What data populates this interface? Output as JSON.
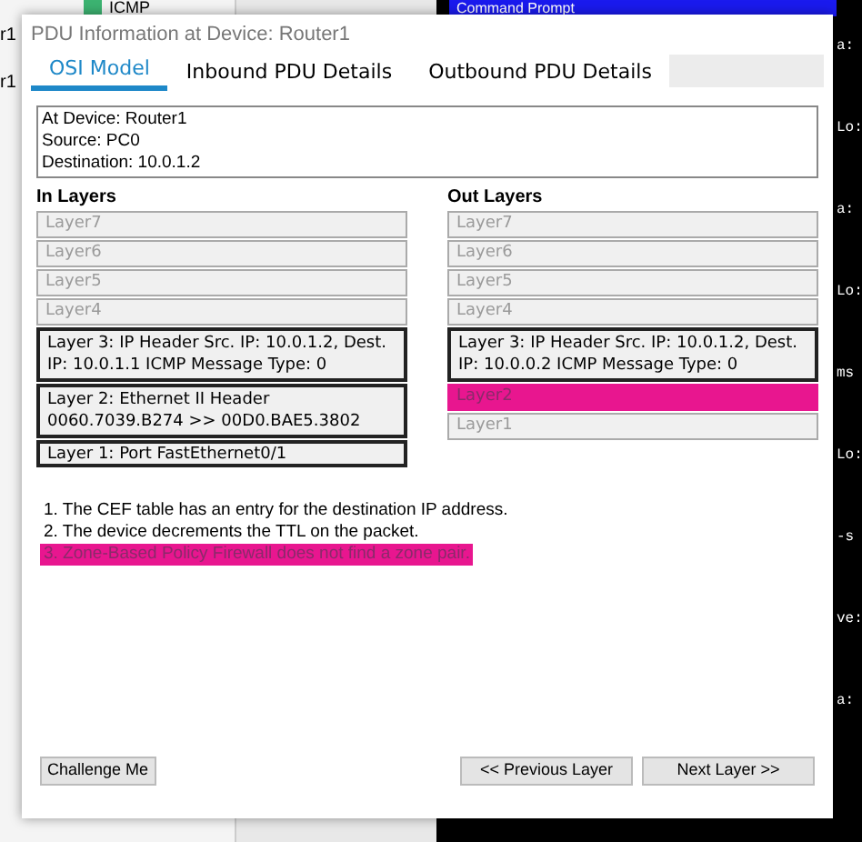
{
  "background": {
    "list_item": "ICMP",
    "terminal_title": "Command Prompt",
    "left_labels": [
      "r1",
      "r1"
    ],
    "terminal_lines": [
      "a:",
      "Lo:",
      "a:",
      "Lo:",
      "ms",
      "Lo:",
      "-s",
      "ve:",
      "a:"
    ]
  },
  "window": {
    "title": "PDU Information at Device: Router1"
  },
  "tabs": [
    {
      "label": "OSI Model",
      "selected": true
    },
    {
      "label": "Inbound PDU Details",
      "selected": false
    },
    {
      "label": "Outbound PDU Details",
      "selected": false
    }
  ],
  "info": [
    "At Device: Router1",
    "Source: PC0",
    "Destination: 10.0.1.2"
  ],
  "in_layers": {
    "heading": "In Layers",
    "layers": [
      {
        "text": "Layer7",
        "active": false,
        "highlighted": false
      },
      {
        "text": "Layer6",
        "active": false,
        "highlighted": false
      },
      {
        "text": "Layer5",
        "active": false,
        "highlighted": false
      },
      {
        "text": "Layer4",
        "active": false,
        "highlighted": false
      },
      {
        "text": "Layer 3: IP Header Src. IP: 10.0.1.2, Dest. IP: 10.0.1.1 ICMP Message Type: 0",
        "active": true,
        "highlighted": false
      },
      {
        "text": "Layer 2: Ethernet II Header 0060.7039.B274 >> 00D0.BAE5.3802",
        "active": true,
        "highlighted": false
      },
      {
        "text": "Layer 1: Port FastEthernet0/1",
        "active": true,
        "highlighted": false
      }
    ]
  },
  "out_layers": {
    "heading": "Out Layers",
    "layers": [
      {
        "text": "Layer7",
        "active": false,
        "highlighted": false
      },
      {
        "text": "Layer6",
        "active": false,
        "highlighted": false
      },
      {
        "text": "Layer5",
        "active": false,
        "highlighted": false
      },
      {
        "text": "Layer4",
        "active": false,
        "highlighted": false
      },
      {
        "text": "Layer 3: IP Header Src. IP: 10.0.1.2, Dest. IP: 10.0.0.2 ICMP Message Type: 0",
        "active": true,
        "highlighted": false
      },
      {
        "text": "Layer2",
        "active": false,
        "highlighted": true
      },
      {
        "text": "Layer1",
        "active": false,
        "highlighted": false
      }
    ]
  },
  "messages": [
    {
      "text": "1. The CEF table has an entry for the destination IP address.",
      "highlighted": false
    },
    {
      "text": "2. The device decrements the TTL on the packet.",
      "highlighted": false
    },
    {
      "text": "3. Zone-Based Policy Firewall does not find a zone pair.",
      "highlighted": true
    }
  ],
  "buttons": {
    "challenge": "Challenge Me",
    "previous": "<< Previous Layer",
    "next": "Next Layer >>"
  }
}
